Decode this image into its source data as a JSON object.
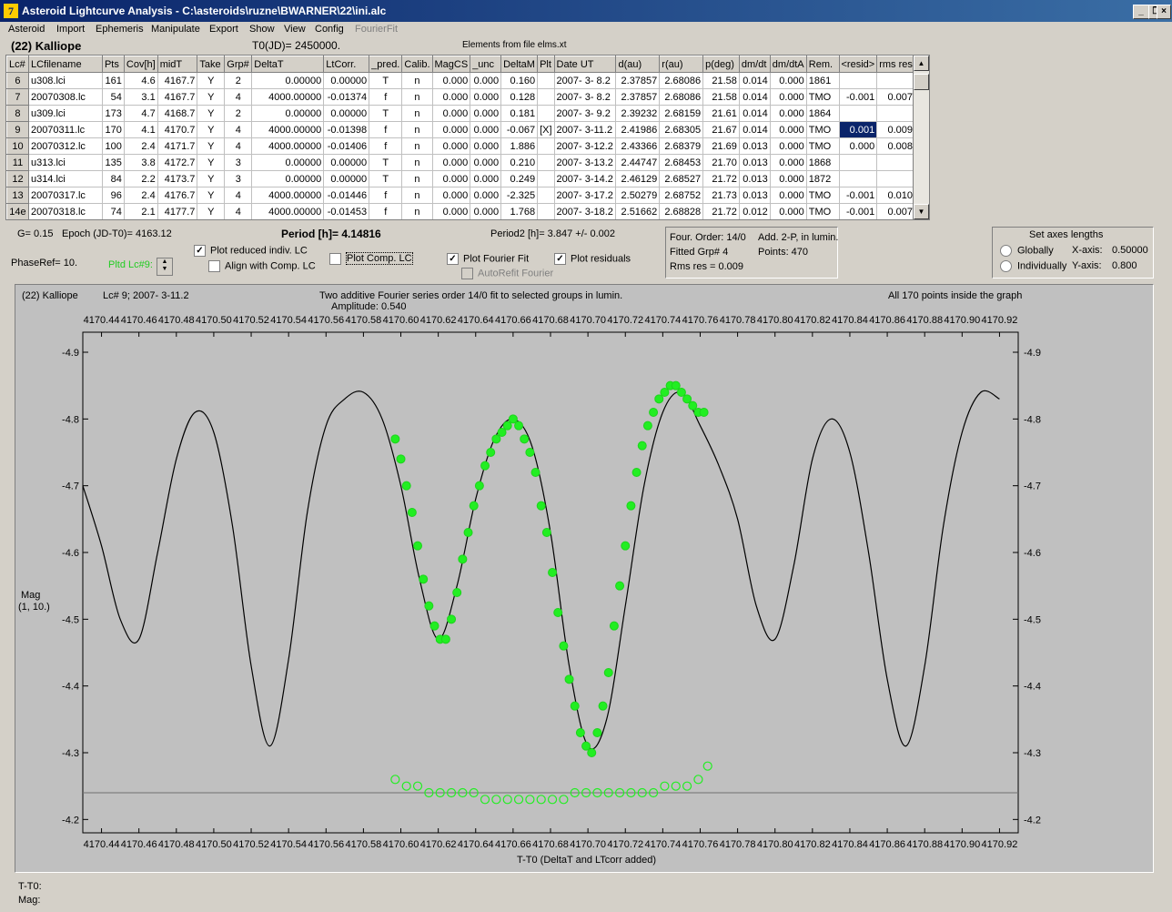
{
  "window": {
    "title": "Asteroid Lightcurve Analysis - C:\\asteroids\\ruzne\\BWARNER\\22\\ini.alc",
    "app_icon": "7"
  },
  "menu": [
    {
      "label": "Asteroid",
      "enabled": true
    },
    {
      "label": "Import",
      "enabled": true
    },
    {
      "label": "Ephemeris",
      "enabled": true
    },
    {
      "label": "Manipulate",
      "enabled": true
    },
    {
      "label": "Export",
      "enabled": true
    },
    {
      "label": "Show",
      "enabled": true
    },
    {
      "label": "View",
      "enabled": true
    },
    {
      "label": "Config",
      "enabled": true
    },
    {
      "label": "FourierFit",
      "enabled": false
    }
  ],
  "header": {
    "asteroid": "(22) Kalliope",
    "t0": "T0(JD)= 2450000.",
    "elements": "Elements from file elms.xt"
  },
  "table": {
    "columns": [
      "Lc#",
      "LCfilename",
      "Pts",
      "Cov[h]",
      "midT",
      "Take",
      "Grp#",
      "DeltaT",
      "LtCorr.",
      "_pred.",
      "Calib.",
      "MagCS",
      "_unc",
      "DeltaM",
      "Plt",
      "Date UT",
      "d(au)",
      "r(au)",
      "p(deg)",
      "dm/dt",
      "dm/dtA",
      "Rem.",
      "<resid>",
      "rms res"
    ],
    "rows": [
      [
        "6",
        "u308.lci",
        "161",
        "4.6",
        "4167.7",
        "Y",
        "2",
        "0.00000",
        "0.00000",
        "T",
        "n",
        "0.000",
        "0.000",
        "0.160",
        "",
        "2007- 3- 8.2",
        "2.37857",
        "2.68086",
        "21.58",
        "0.014",
        "0.000",
        "1861",
        "",
        ""
      ],
      [
        "7",
        "20070308.lc",
        "54",
        "3.1",
        "4167.7",
        "Y",
        "4",
        "4000.00000",
        "-0.01374",
        "f",
        "n",
        "0.000",
        "0.000",
        "0.128",
        "",
        "2007- 3- 8.2",
        "2.37857",
        "2.68086",
        "21.58",
        "0.014",
        "0.000",
        "TMO",
        "-0.001",
        "0.007"
      ],
      [
        "8",
        "u309.lci",
        "173",
        "4.7",
        "4168.7",
        "Y",
        "2",
        "0.00000",
        "0.00000",
        "T",
        "n",
        "0.000",
        "0.000",
        "0.181",
        "",
        "2007- 3- 9.2",
        "2.39232",
        "2.68159",
        "21.61",
        "0.014",
        "0.000",
        "1864",
        "",
        ""
      ],
      [
        "9",
        "20070311.lc",
        "170",
        "4.1",
        "4170.7",
        "Y",
        "4",
        "4000.00000",
        "-0.01398",
        "f",
        "n",
        "0.000",
        "0.000",
        "-0.067",
        "[X]",
        "2007- 3-11.2",
        "2.41986",
        "2.68305",
        "21.67",
        "0.014",
        "0.000",
        "TMO",
        "0.001",
        "0.009"
      ],
      [
        "10",
        "20070312.lc",
        "100",
        "2.4",
        "4171.7",
        "Y",
        "4",
        "4000.00000",
        "-0.01406",
        "f",
        "n",
        "0.000",
        "0.000",
        "1.886",
        "",
        "2007- 3-12.2",
        "2.43366",
        "2.68379",
        "21.69",
        "0.013",
        "0.000",
        "TMO",
        "0.000",
        "0.008"
      ],
      [
        "11",
        "u313.lci",
        "135",
        "3.8",
        "4172.7",
        "Y",
        "3",
        "0.00000",
        "0.00000",
        "T",
        "n",
        "0.000",
        "0.000",
        "0.210",
        "",
        "2007- 3-13.2",
        "2.44747",
        "2.68453",
        "21.70",
        "0.013",
        "0.000",
        "1868",
        "",
        ""
      ],
      [
        "12",
        "u314.lci",
        "84",
        "2.2",
        "4173.7",
        "Y",
        "3",
        "0.00000",
        "0.00000",
        "T",
        "n",
        "0.000",
        "0.000",
        "0.249",
        "",
        "2007- 3-14.2",
        "2.46129",
        "2.68527",
        "21.72",
        "0.013",
        "0.000",
        "1872",
        "",
        ""
      ],
      [
        "13",
        "20070317.lc",
        "96",
        "2.4",
        "4176.7",
        "Y",
        "4",
        "4000.00000",
        "-0.01446",
        "f",
        "n",
        "0.000",
        "0.000",
        "-2.325",
        "",
        "2007- 3-17.2",
        "2.50279",
        "2.68752",
        "21.73",
        "0.013",
        "0.000",
        "TMO",
        "-0.001",
        "0.010"
      ],
      [
        "14e",
        "20070318.lc",
        "74",
        "2.1",
        "4177.7",
        "Y",
        "4",
        "4000.00000",
        "-0.01453",
        "f",
        "n",
        "0.000",
        "0.000",
        "1.768",
        "",
        "2007- 3-18.2",
        "2.51662",
        "2.68828",
        "21.72",
        "0.012",
        "0.000",
        "TMO",
        "-0.001",
        "0.007"
      ]
    ]
  },
  "controls": {
    "g": "G= 0.15",
    "epoch": "Epoch (JD-T0)= 4163.12",
    "period": "Period [h]= 4.14816",
    "period2": "Period2 [h]= 3.847 +/- 0.002",
    "phaseref": "PhaseRef= 10.",
    "pltd": "Pltd Lc#9:",
    "plot_reduced": "Plot reduced indiv. LC",
    "plot_reduced_checked": true,
    "align": "Align with Comp. LC",
    "align_checked": false,
    "plot_comp": "Plot Comp. LC",
    "plot_comp_checked": false,
    "plot_fourier": "Plot Fourier Fit",
    "plot_fourier_checked": true,
    "autorefit": "AutoRefit Fourier",
    "autorefit_checked": false,
    "plot_resid": "Plot residuals",
    "plot_resid_checked": true,
    "info1": "Four. Order: 14/0",
    "info2": "Add. 2-P, in lumin.",
    "info3": "Fitted Grp# 4",
    "info4": "Points: 470",
    "info5": "Rms res     = 0.009",
    "axes_title": "Set axes lengths",
    "globally": "Globally",
    "individually": "Individually",
    "xaxis_label": "X-axis:",
    "xaxis_val": "0.50000",
    "yaxis_label": "Y-axis:",
    "yaxis_val": "0.800"
  },
  "plot": {
    "title_left": "(22) Kalliope",
    "title_lc": "Lc# 9; 2007- 3-11.2",
    "title_center": "Two additive Fourier series order 14/0 fit to selected groups in lumin.",
    "amplitude": "Amplitude: 0.540",
    "title_right": "All 170 points inside the graph",
    "ylabel": "Mag",
    "ylabel2": "(1, 10.)",
    "xlabel": "T-T0 (DeltaT and LTcorr added)",
    "status_t": "T-T0:",
    "status_mag": "Mag:"
  },
  "chart_data": {
    "type": "scatter",
    "x_range": [
      4170.43,
      4170.93
    ],
    "y_range": [
      -4.93,
      -4.18
    ],
    "y_inverted": true,
    "x_ticks": [
      "4170.44",
      "4170.46",
      "4170.48",
      "4170.50",
      "4170.52",
      "4170.54",
      "4170.56",
      "4170.58",
      "4170.60",
      "4170.62",
      "4170.64",
      "4170.66",
      "4170.68",
      "4170.70",
      "4170.72",
      "4170.74",
      "4170.76",
      "4170.78",
      "4170.80",
      "4170.82",
      "4170.84",
      "4170.86",
      "4170.88",
      "4170.90",
      "4170.92"
    ],
    "y_ticks": [
      "-4.9",
      "-4.8",
      "-4.7",
      "-4.6",
      "-4.5",
      "-4.4",
      "-4.3",
      "-4.2"
    ],
    "residual_baseline": -4.24,
    "fourier_fit": [
      [
        4170.43,
        -4.7
      ],
      [
        4170.44,
        -4.61
      ],
      [
        4170.45,
        -4.5
      ],
      [
        4170.46,
        -4.47
      ],
      [
        4170.47,
        -4.6
      ],
      [
        4170.48,
        -4.74
      ],
      [
        4170.49,
        -4.81
      ],
      [
        4170.5,
        -4.78
      ],
      [
        4170.51,
        -4.64
      ],
      [
        4170.52,
        -4.43
      ],
      [
        4170.53,
        -4.31
      ],
      [
        4170.54,
        -4.44
      ],
      [
        4170.55,
        -4.66
      ],
      [
        4170.56,
        -4.79
      ],
      [
        4170.57,
        -4.83
      ],
      [
        4170.58,
        -4.84
      ],
      [
        4170.59,
        -4.8
      ],
      [
        4170.6,
        -4.7
      ],
      [
        4170.61,
        -4.56
      ],
      [
        4170.62,
        -4.47
      ],
      [
        4170.63,
        -4.55
      ],
      [
        4170.64,
        -4.68
      ],
      [
        4170.65,
        -4.77
      ],
      [
        4170.66,
        -4.8
      ],
      [
        4170.67,
        -4.76
      ],
      [
        4170.68,
        -4.63
      ],
      [
        4170.69,
        -4.43
      ],
      [
        4170.7,
        -4.31
      ],
      [
        4170.71,
        -4.35
      ],
      [
        4170.72,
        -4.52
      ],
      [
        4170.73,
        -4.7
      ],
      [
        4170.74,
        -4.81
      ],
      [
        4170.75,
        -4.84
      ],
      [
        4170.76,
        -4.79
      ],
      [
        4170.77,
        -4.73
      ],
      [
        4170.78,
        -4.65
      ],
      [
        4170.79,
        -4.52
      ],
      [
        4170.8,
        -4.47
      ],
      [
        4170.81,
        -4.58
      ],
      [
        4170.82,
        -4.74
      ],
      [
        4170.83,
        -4.8
      ],
      [
        4170.84,
        -4.75
      ],
      [
        4170.85,
        -4.6
      ],
      [
        4170.86,
        -4.41
      ],
      [
        4170.87,
        -4.31
      ],
      [
        4170.88,
        -4.43
      ],
      [
        4170.89,
        -4.64
      ],
      [
        4170.9,
        -4.78
      ],
      [
        4170.91,
        -4.84
      ],
      [
        4170.92,
        -4.83
      ]
    ],
    "observations": [
      [
        4170.597,
        -4.77
      ],
      [
        4170.6,
        -4.74
      ],
      [
        4170.603,
        -4.7
      ],
      [
        4170.606,
        -4.66
      ],
      [
        4170.609,
        -4.61
      ],
      [
        4170.612,
        -4.56
      ],
      [
        4170.615,
        -4.52
      ],
      [
        4170.618,
        -4.49
      ],
      [
        4170.621,
        -4.47
      ],
      [
        4170.624,
        -4.47
      ],
      [
        4170.627,
        -4.5
      ],
      [
        4170.63,
        -4.54
      ],
      [
        4170.633,
        -4.59
      ],
      [
        4170.636,
        -4.63
      ],
      [
        4170.639,
        -4.67
      ],
      [
        4170.642,
        -4.7
      ],
      [
        4170.645,
        -4.73
      ],
      [
        4170.648,
        -4.75
      ],
      [
        4170.651,
        -4.77
      ],
      [
        4170.654,
        -4.78
      ],
      [
        4170.657,
        -4.79
      ],
      [
        4170.66,
        -4.8
      ],
      [
        4170.663,
        -4.79
      ],
      [
        4170.666,
        -4.77
      ],
      [
        4170.669,
        -4.75
      ],
      [
        4170.672,
        -4.72
      ],
      [
        4170.675,
        -4.67
      ],
      [
        4170.678,
        -4.63
      ],
      [
        4170.681,
        -4.57
      ],
      [
        4170.684,
        -4.51
      ],
      [
        4170.687,
        -4.46
      ],
      [
        4170.69,
        -4.41
      ],
      [
        4170.693,
        -4.37
      ],
      [
        4170.696,
        -4.33
      ],
      [
        4170.699,
        -4.31
      ],
      [
        4170.702,
        -4.3
      ],
      [
        4170.705,
        -4.33
      ],
      [
        4170.708,
        -4.37
      ],
      [
        4170.711,
        -4.42
      ],
      [
        4170.714,
        -4.49
      ],
      [
        4170.717,
        -4.55
      ],
      [
        4170.72,
        -4.61
      ],
      [
        4170.723,
        -4.67
      ],
      [
        4170.726,
        -4.72
      ],
      [
        4170.729,
        -4.76
      ],
      [
        4170.732,
        -4.79
      ],
      [
        4170.735,
        -4.81
      ],
      [
        4170.738,
        -4.83
      ],
      [
        4170.741,
        -4.84
      ],
      [
        4170.744,
        -4.85
      ],
      [
        4170.747,
        -4.85
      ],
      [
        4170.75,
        -4.84
      ],
      [
        4170.753,
        -4.83
      ],
      [
        4170.756,
        -4.82
      ],
      [
        4170.759,
        -4.81
      ],
      [
        4170.762,
        -4.81
      ]
    ],
    "residuals": [
      [
        4170.597,
        -4.26
      ],
      [
        4170.603,
        -4.25
      ],
      [
        4170.609,
        -4.25
      ],
      [
        4170.615,
        -4.24
      ],
      [
        4170.621,
        -4.24
      ],
      [
        4170.627,
        -4.24
      ],
      [
        4170.633,
        -4.24
      ],
      [
        4170.639,
        -4.24
      ],
      [
        4170.645,
        -4.23
      ],
      [
        4170.651,
        -4.23
      ],
      [
        4170.657,
        -4.23
      ],
      [
        4170.663,
        -4.23
      ],
      [
        4170.669,
        -4.23
      ],
      [
        4170.675,
        -4.23
      ],
      [
        4170.681,
        -4.23
      ],
      [
        4170.687,
        -4.23
      ],
      [
        4170.693,
        -4.24
      ],
      [
        4170.699,
        -4.24
      ],
      [
        4170.705,
        -4.24
      ],
      [
        4170.711,
        -4.24
      ],
      [
        4170.717,
        -4.24
      ],
      [
        4170.723,
        -4.24
      ],
      [
        4170.729,
        -4.24
      ],
      [
        4170.735,
        -4.24
      ],
      [
        4170.741,
        -4.25
      ],
      [
        4170.747,
        -4.25
      ],
      [
        4170.753,
        -4.25
      ],
      [
        4170.759,
        -4.26
      ],
      [
        4170.764,
        -4.28
      ]
    ],
    "colors": {
      "points": "#22ee22",
      "fit": "#000000",
      "background": "#c0c0c0"
    }
  }
}
